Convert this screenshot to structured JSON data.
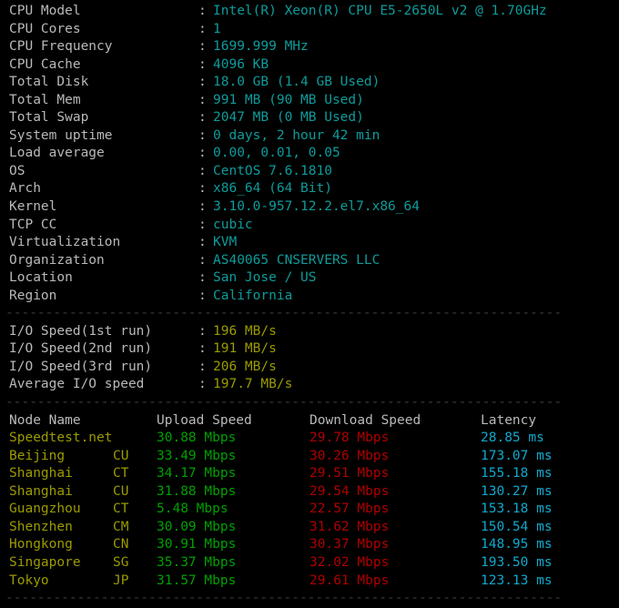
{
  "colors": {
    "background": "#000000",
    "label": "#b9b9b9",
    "value_cyan": "#0f9b9b",
    "io_yellow": "#9b9b00",
    "node_yellow": "#9b9b00",
    "upload_green": "#00a000",
    "download_red": "#ae0000",
    "latency_cyan": "#12a8cd",
    "divider": "#3c3c3c"
  },
  "separator": "----------------------------------------------------------------------",
  "colon": ":",
  "system_info": {
    "rows": [
      {
        "label": "CPU Model",
        "value": "Intel(R) Xeon(R) CPU E5-2650L v2 @ 1.70GHz"
      },
      {
        "label": "CPU Cores",
        "value": "1"
      },
      {
        "label": "CPU Frequency",
        "value": "1699.999 MHz"
      },
      {
        "label": "CPU Cache",
        "value": "4096 KB"
      },
      {
        "label": "Total Disk",
        "value": "18.0 GB (1.4 GB Used)"
      },
      {
        "label": "Total Mem",
        "value": "991 MB (90 MB Used)"
      },
      {
        "label": "Total Swap",
        "value": "2047 MB (0 MB Used)"
      },
      {
        "label": "System uptime",
        "value": "0 days, 2 hour 42 min"
      },
      {
        "label": "Load average",
        "value": "0.00, 0.01, 0.05"
      },
      {
        "label": "OS",
        "value": "CentOS 7.6.1810"
      },
      {
        "label": "Arch",
        "value": "x86_64 (64 Bit)"
      },
      {
        "label": "Kernel",
        "value": "3.10.0-957.12.2.el7.x86_64"
      },
      {
        "label": "TCP CC",
        "value": "cubic"
      },
      {
        "label": "Virtualization",
        "value": "KVM"
      },
      {
        "label": "Organization",
        "value": "AS40065 CNSERVERS LLC"
      },
      {
        "label": "Location",
        "value": "San Jose / US"
      },
      {
        "label": "Region",
        "value": "California"
      }
    ]
  },
  "io_speed": {
    "rows": [
      {
        "label": "I/O Speed(1st run)",
        "value": "196 MB/s"
      },
      {
        "label": "I/O Speed(2nd run)",
        "value": "191 MB/s"
      },
      {
        "label": "I/O Speed(3rd run)",
        "value": "206 MB/s"
      },
      {
        "label": "Average I/O speed",
        "value": "197.7 MB/s"
      }
    ]
  },
  "speedtest": {
    "headers": {
      "node": "Node Name",
      "carrier": "",
      "upload": "Upload Speed",
      "download": "Download Speed",
      "latency": "Latency"
    },
    "rows": [
      {
        "node": "Speedtest.net",
        "carrier": "",
        "upload": "30.88 Mbps",
        "download": "29.78 Mbps",
        "latency": "28.85 ms"
      },
      {
        "node": "Beijing",
        "carrier": "CU",
        "upload": "33.49 Mbps",
        "download": "30.26 Mbps",
        "latency": "173.07 ms"
      },
      {
        "node": "Shanghai",
        "carrier": "CT",
        "upload": "34.17 Mbps",
        "download": "29.51 Mbps",
        "latency": "155.18 ms"
      },
      {
        "node": "Shanghai",
        "carrier": "CU",
        "upload": "31.88 Mbps",
        "download": "29.54 Mbps",
        "latency": "130.27 ms"
      },
      {
        "node": "Guangzhou",
        "carrier": "CT",
        "upload": "5.48 Mbps",
        "download": "22.57 Mbps",
        "latency": "153.18 ms"
      },
      {
        "node": "Shenzhen",
        "carrier": "CM",
        "upload": "30.09 Mbps",
        "download": "31.62 Mbps",
        "latency": "150.54 ms"
      },
      {
        "node": "Hongkong",
        "carrier": "CN",
        "upload": "30.91 Mbps",
        "download": "30.37 Mbps",
        "latency": "148.95 ms"
      },
      {
        "node": "Singapore",
        "carrier": "SG",
        "upload": "35.37 Mbps",
        "download": "32.02 Mbps",
        "latency": "193.50 ms"
      },
      {
        "node": "Tokyo",
        "carrier": "JP",
        "upload": "31.57 Mbps",
        "download": "29.61 Mbps",
        "latency": "123.13 ms"
      }
    ]
  }
}
